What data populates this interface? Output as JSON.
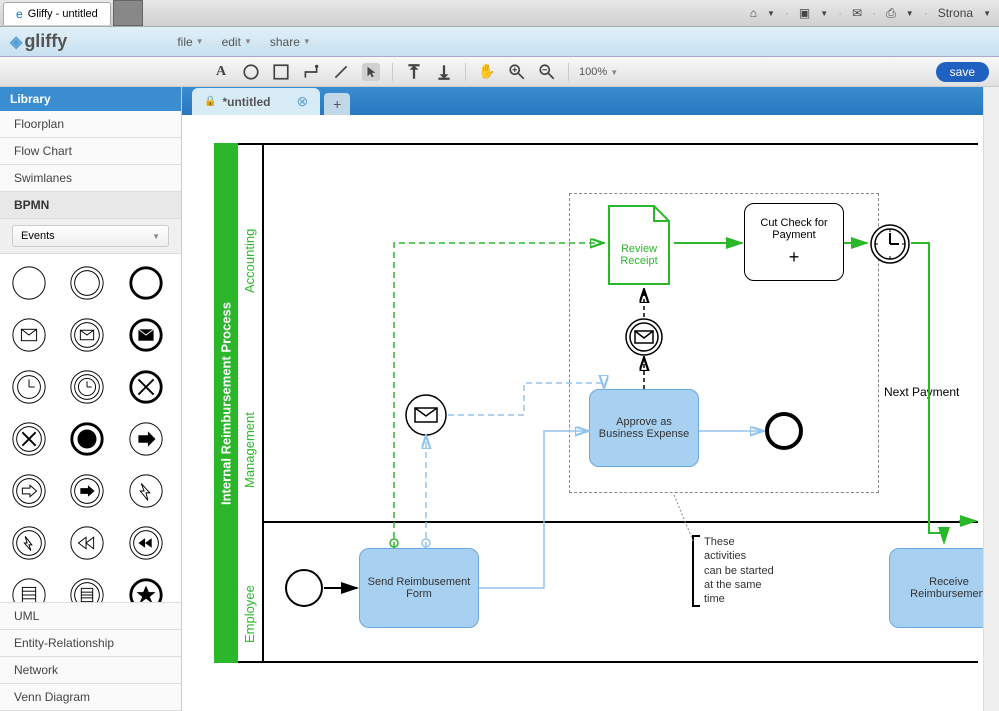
{
  "browser": {
    "tab_title": "Gliffy - untitled",
    "toolbar_page_label": "Strona"
  },
  "app": {
    "logo_text": "gliffy",
    "menus": {
      "file": "file",
      "edit": "edit",
      "share": "share"
    }
  },
  "toolbar": {
    "zoom": "100%",
    "save": "save"
  },
  "sidebar": {
    "header": "Library",
    "cats": [
      "Floorplan",
      "Flow Chart",
      "Swimlanes",
      "BPMN"
    ],
    "dropdown": "Events",
    "bottom_cats": [
      "UML",
      "Entity-Relationship",
      "Network",
      "Venn Diagram"
    ]
  },
  "tabs": {
    "doc_title": "*untitled"
  },
  "diagram": {
    "title": "Internal Reimbursement Process",
    "lanes": {
      "accounting": "Accounting",
      "management": "Management",
      "employee": "Employee"
    },
    "nodes": {
      "review_receipt": "Review Receipt",
      "cut_check": "Cut Check for Payment",
      "approve_expense": "Approve as Business Expense",
      "send_form": "Send Reimbusement Form",
      "receive_reimbursement": "Receive Reimbursement",
      "next_payment": "Next Payment"
    },
    "note": "These\nactivities\ncan be started\nat the same\ntime"
  }
}
